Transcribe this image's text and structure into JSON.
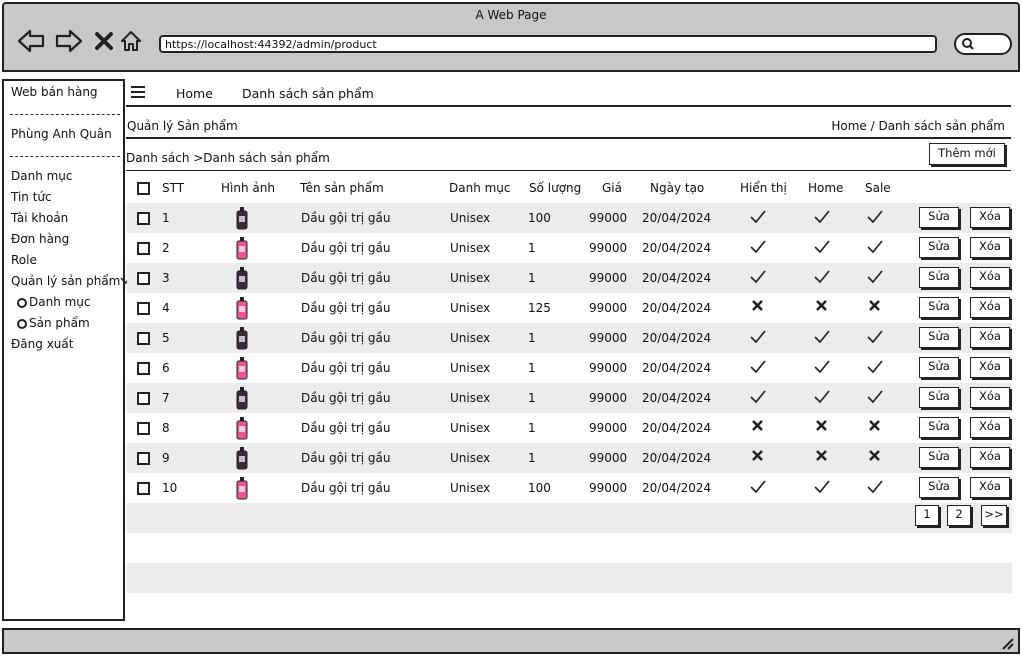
{
  "browser": {
    "window_title": "A Web Page",
    "url": "https://localhost:44392/admin/product"
  },
  "sidebar": {
    "brand": "Web bán hàng",
    "user": "Phùng Anh Quân",
    "items": [
      "Danh mục",
      "Tin tức",
      "Tài khoản",
      "Đơn hàng",
      "Role",
      "Quản lý sản phẩm"
    ],
    "subitems": [
      "Danh mục",
      "Sản phẩm"
    ],
    "logout": "Đăng xuất"
  },
  "topnav": {
    "home": "Home",
    "product_list": "Danh sách sản phẩm"
  },
  "page": {
    "title": "Quản lý Sản phẩm",
    "breadcrumb": "Home / Danh sách sản phẩm",
    "section_title": "Danh sách >Danh sách sản phẩm",
    "add_button": "Thêm mới"
  },
  "table": {
    "headers": [
      "STT",
      "Hình ảnh",
      "Tên sản phẩm",
      "Danh mục",
      "Số lượng",
      "Giá",
      "Ngày tạo",
      "Hiển thị",
      "Home",
      "Sale"
    ],
    "rows": [
      {
        "stt": "1",
        "name": "Dầu gội trị gầu",
        "category": "Unisex",
        "qty": "100",
        "price": "99000",
        "date": "20/04/2024",
        "show": true,
        "home": true,
        "sale": true,
        "img": "dark"
      },
      {
        "stt": "2",
        "name": "Dầu gội trị gầu",
        "category": "Unisex",
        "qty": "1",
        "price": "99000",
        "date": "20/04/2024",
        "show": true,
        "home": true,
        "sale": true,
        "img": "pink"
      },
      {
        "stt": "3",
        "name": "Dầu gội trị gầu",
        "category": "Unisex",
        "qty": "1",
        "price": "99000",
        "date": "20/04/2024",
        "show": true,
        "home": true,
        "sale": true,
        "img": "dark"
      },
      {
        "stt": "4",
        "name": "Dầu gội trị gầu",
        "category": "Unisex",
        "qty": "125",
        "price": "99000",
        "date": "20/04/2024",
        "show": false,
        "home": false,
        "sale": false,
        "img": "pink"
      },
      {
        "stt": "5",
        "name": "Dầu gội trị gầu",
        "category": "Unisex",
        "qty": "1",
        "price": "99000",
        "date": "20/04/2024",
        "show": true,
        "home": true,
        "sale": true,
        "img": "dark"
      },
      {
        "stt": "6",
        "name": "Dầu gội trị gầu",
        "category": "Unisex",
        "qty": "1",
        "price": "99000",
        "date": "20/04/2024",
        "show": true,
        "home": true,
        "sale": true,
        "img": "pink"
      },
      {
        "stt": "7",
        "name": "Dầu gội trị gầu",
        "category": "Unisex",
        "qty": "1",
        "price": "99000",
        "date": "20/04/2024",
        "show": true,
        "home": true,
        "sale": true,
        "img": "dark"
      },
      {
        "stt": "8",
        "name": "Dầu gội trị gầu",
        "category": "Unisex",
        "qty": "1",
        "price": "99000",
        "date": "20/04/2024",
        "show": false,
        "home": false,
        "sale": false,
        "img": "pink"
      },
      {
        "stt": "9",
        "name": "Dầu gội trị gầu",
        "category": "Unisex",
        "qty": "1",
        "price": "99000",
        "date": "20/04/2024",
        "show": false,
        "home": false,
        "sale": false,
        "img": "dark"
      },
      {
        "stt": "10",
        "name": "Dầu gội trị gầu",
        "category": "Unisex",
        "qty": "100",
        "price": "99000",
        "date": "20/04/2024",
        "show": true,
        "home": true,
        "sale": true,
        "img": "pink"
      }
    ],
    "edit_label": "Sửa",
    "delete_label": "Xóa"
  },
  "pagination": {
    "pages": [
      "1",
      "2"
    ],
    "next": ">>"
  },
  "icons": {
    "back": "back-arrow-icon",
    "forward": "forward-arrow-icon",
    "close": "close-icon",
    "home": "home-icon",
    "search": "search-icon",
    "menu": "hamburger-icon",
    "check": "check-icon",
    "cross": "cross-icon",
    "chevron": "chevron-down-icon",
    "resize": "resize-grip-icon"
  },
  "colors": {
    "chrome": "#c8c8c8",
    "stripe": "#ececec",
    "bottle_dark": "#3a2a38",
    "bottle_pink": "#e8558f"
  }
}
